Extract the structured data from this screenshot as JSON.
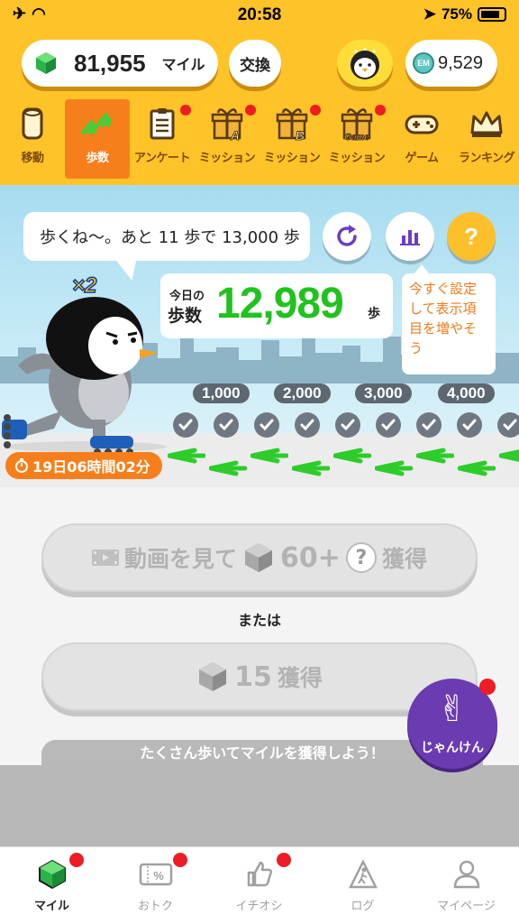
{
  "status_bar": {
    "time": "20:58",
    "battery": "75%"
  },
  "header": {
    "miles_value": "81,955",
    "miles_unit": "マイル",
    "exchange_label": "交換",
    "coin_value": "9,529",
    "coin_icon_text": "EM"
  },
  "tabs": [
    {
      "label": "移動",
      "icon": "can-icon",
      "active": false,
      "badge": false
    },
    {
      "label": "歩数",
      "icon": "footprints-icon",
      "active": true,
      "badge": false
    },
    {
      "label": "アンケート",
      "icon": "clipboard-icon",
      "active": false,
      "badge": true
    },
    {
      "label": "ミッション",
      "icon": "gift-a-icon",
      "active": false,
      "badge": true,
      "mark": "A"
    },
    {
      "label": "ミッション",
      "icon": "gift-b-icon",
      "active": false,
      "badge": true,
      "mark": "B"
    },
    {
      "label": "ミッション",
      "icon": "gift-game-icon",
      "active": false,
      "badge": true,
      "mark": "Game"
    },
    {
      "label": "ゲーム",
      "icon": "gamepad-icon",
      "active": false,
      "badge": false
    },
    {
      "label": "ランキング",
      "icon": "crown-icon",
      "active": false,
      "badge": false
    }
  ],
  "scene": {
    "speech": "歩くね〜。あと 11 歩で 13,000 歩",
    "multiplier": "×2",
    "today_label_1": "今日の",
    "today_label_2": "歩数",
    "steps": "12,989",
    "steps_unit": "歩",
    "hint": "今すぐ設定して表示項目を増やそう",
    "milestones": [
      "1,000",
      "2,000",
      "3,000",
      "4,000"
    ],
    "timer": "19日06時間02分"
  },
  "actions": {
    "video_prefix": "動画を見て",
    "video_amount": "60+",
    "video_suffix": "獲得",
    "or_label": "または",
    "earn_amount": "15",
    "earn_suffix": "獲得",
    "tip": "たくさん歩いてマイルを獲得しよう！",
    "janken_label": "じゃんけん"
  },
  "bottom_nav": [
    {
      "label": "マイル",
      "icon": "gem-icon",
      "active": true,
      "badge": true
    },
    {
      "label": "おトク",
      "icon": "coupon-icon",
      "active": false,
      "badge": true
    },
    {
      "label": "イチオシ",
      "icon": "thumbs-up-icon",
      "active": false,
      "badge": true
    },
    {
      "label": "ログ",
      "icon": "walker-icon",
      "active": false,
      "badge": false
    },
    {
      "label": "マイページ",
      "icon": "person-icon",
      "active": false,
      "badge": false
    }
  ],
  "colors": {
    "brand_yellow": "#fec328",
    "active_orange": "#f77f1b",
    "steps_green": "#21c21f",
    "badge_red": "#ee1c25"
  }
}
